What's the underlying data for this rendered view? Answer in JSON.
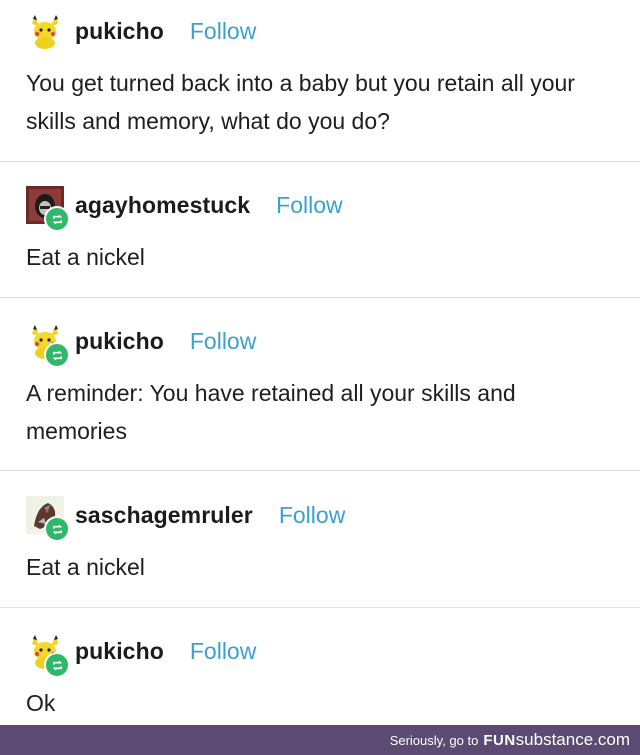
{
  "posts": [
    {
      "username": "pukicho",
      "follow": "Follow",
      "avatar": "pikachu-avatar",
      "reblog": false,
      "text": "You get turned back into a baby but you retain all your skills and memory, what do you do?"
    },
    {
      "username": "agayhomestuck",
      "follow": "Follow",
      "avatar": "homestuck-avatar",
      "reblog": true,
      "text": "Eat a nickel"
    },
    {
      "username": "pukicho",
      "follow": "Follow",
      "avatar": "pikachu-avatar",
      "reblog": true,
      "text": "A reminder: You have retained all your skills and memories"
    },
    {
      "username": "saschagemruler",
      "follow": "Follow",
      "avatar": "dragon-avatar",
      "reblog": true,
      "text": "Eat a nickel"
    },
    {
      "username": "pukicho",
      "follow": "Follow",
      "avatar": "pikachu-avatar",
      "reblog": true,
      "text": "Ok"
    }
  ],
  "footer": {
    "prefix": "Seriously, go to",
    "brand_bold": "FUN",
    "brand_rest": "substance.com"
  },
  "colors": {
    "follow": "#3aa1cf",
    "reblog_badge": "#2fb86a",
    "footer_bg": "#5b4a72"
  }
}
